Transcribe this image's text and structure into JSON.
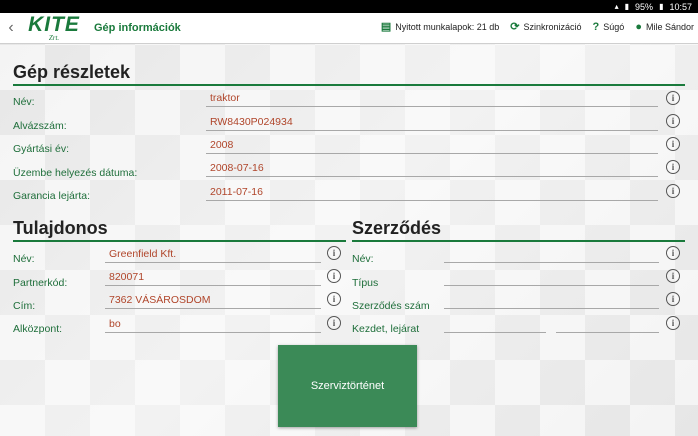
{
  "status_bar": {
    "battery": "95%",
    "time": "10:57"
  },
  "app_bar": {
    "logo_text": "KITE",
    "logo_sub": "Zrt.",
    "title": "Gép információk",
    "actions": [
      {
        "icon": "clipboard-icon",
        "label": "Nyitott munkalapok: 21 db"
      },
      {
        "icon": "sync-icon",
        "label": "Szinkronizáció"
      },
      {
        "icon": "help-icon",
        "label": "Súgó"
      },
      {
        "icon": "user-icon",
        "label": "Mile Sándor"
      }
    ]
  },
  "machine": {
    "title": "Gép részletek",
    "fields": [
      {
        "label": "Név:",
        "value": "traktor"
      },
      {
        "label": "Alvázszám:",
        "value": "RW8430P024934"
      },
      {
        "label": "Gyártási év:",
        "value": "2008"
      },
      {
        "label": "Üzembe helyezés dátuma:",
        "value": "2008-07-16"
      },
      {
        "label": "Garancia lejárta:",
        "value": "2011-07-16"
      }
    ]
  },
  "owner": {
    "title": "Tulajdonos",
    "fields": [
      {
        "label": "Név:",
        "value": "Greenfield Kft."
      },
      {
        "label": "Partnerkód:",
        "value": "820071"
      },
      {
        "label": "Cím:",
        "value": "7362 VÁSÁROSDOM"
      },
      {
        "label": "Alközpont:",
        "value": "bo"
      }
    ]
  },
  "contract": {
    "title": "Szerződés",
    "fields": [
      {
        "label": "Név:",
        "value": ""
      },
      {
        "label": "Típus",
        "value": ""
      },
      {
        "label": "Szerződés szám",
        "value": ""
      },
      {
        "label": "Kezdet, lejárat",
        "value": "",
        "value2": ""
      }
    ]
  },
  "info_glyph": "i",
  "service_button": {
    "label": "Szerviztörténet"
  },
  "colors": {
    "accent": "#1a7a3c",
    "value_text": "#b0452a",
    "button": "#3b8a57"
  }
}
